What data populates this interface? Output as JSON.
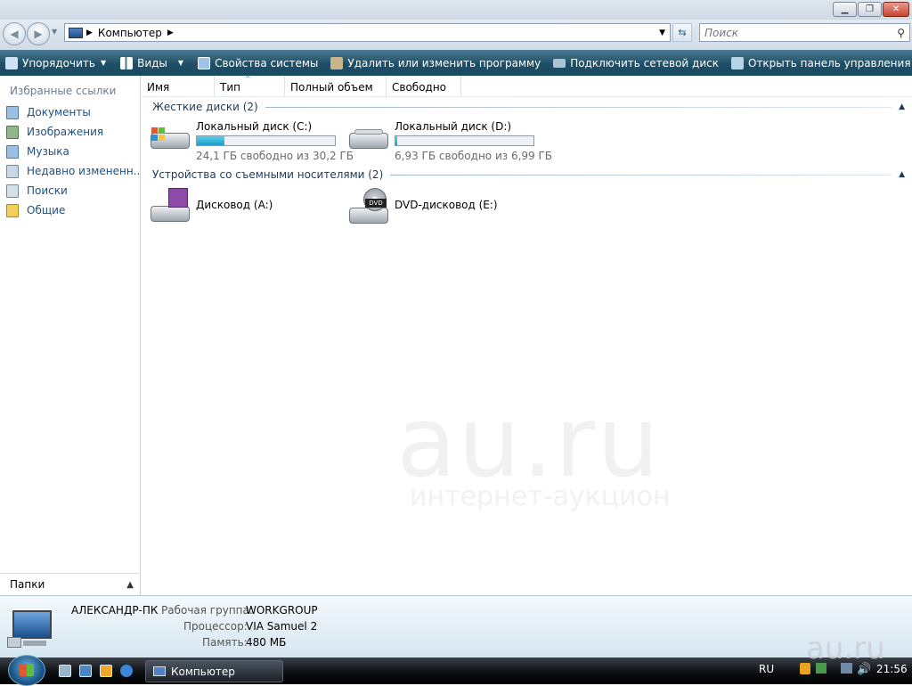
{
  "window": {
    "title": "Компьютер"
  },
  "address": {
    "crumbs": [
      "Компьютер"
    ],
    "search_placeholder": "Поиск"
  },
  "toolbar": {
    "items": [
      {
        "label": "Упорядочить",
        "icon": "organize-icon",
        "has_menu": true
      },
      {
        "label": "Виды",
        "icon": "views-icon",
        "has_menu": true
      },
      {
        "label": "Свойства системы",
        "icon": "system-properties-icon"
      },
      {
        "label": "Удалить или изменить программу",
        "icon": "uninstall-icon"
      },
      {
        "label": "Подключить сетевой диск",
        "icon": "network-drive-icon"
      },
      {
        "label": "Открыть панель управления",
        "icon": "control-panel-icon"
      }
    ]
  },
  "sidebar": {
    "header": "Избранные ссылки",
    "items": [
      {
        "label": "Документы",
        "icon": "documents-icon"
      },
      {
        "label": "Изображения",
        "icon": "pictures-icon"
      },
      {
        "label": "Музыка",
        "icon": "music-icon"
      },
      {
        "label": "Недавно измененн...",
        "icon": "recent-icon"
      },
      {
        "label": "Поиски",
        "icon": "searches-icon"
      },
      {
        "label": "Общие",
        "icon": "public-folder-icon"
      }
    ],
    "folders_label": "Папки"
  },
  "columns": [
    "Имя",
    "Тип",
    "Полный объем",
    "Свободно"
  ],
  "groups": [
    {
      "title": "Жесткие диски (2)",
      "drives": [
        {
          "name": "Локальный диск (C:)",
          "free": "24,1 ГБ свободно из 30,2 ГБ",
          "used_fraction": 0.2
        },
        {
          "name": "Локальный диск (D:)",
          "free": "6,93 ГБ свободно из 6,99 ГБ",
          "used_fraction": 0.01
        }
      ]
    },
    {
      "title": "Устройства со съемными носителями (2)",
      "drives": [
        {
          "name": "Дисковод (A:)",
          "icon": "floppy-drive-icon"
        },
        {
          "name": "DVD-дисковод (E:)",
          "icon": "dvd-drive-icon"
        }
      ]
    }
  ],
  "details": {
    "computer_name": "АЛЕКСАНДР-ПК",
    "workgroup_label": "Рабочая группа:",
    "workgroup": "WORKGROUP",
    "cpu_label": "Процессор:",
    "cpu": "VIA Samuel 2",
    "memory_label": "Память:",
    "memory": "480 МБ"
  },
  "taskbar": {
    "task_label": "Компьютер",
    "lang": "RU",
    "time": "21:56"
  },
  "watermark": {
    "main": "au.ru",
    "sub": "интернет-аукцион",
    "corner": "au.ru"
  },
  "colors": {
    "toolbar": "#1f4f67",
    "link": "#1c5180",
    "progress": "#1e9bc9"
  }
}
